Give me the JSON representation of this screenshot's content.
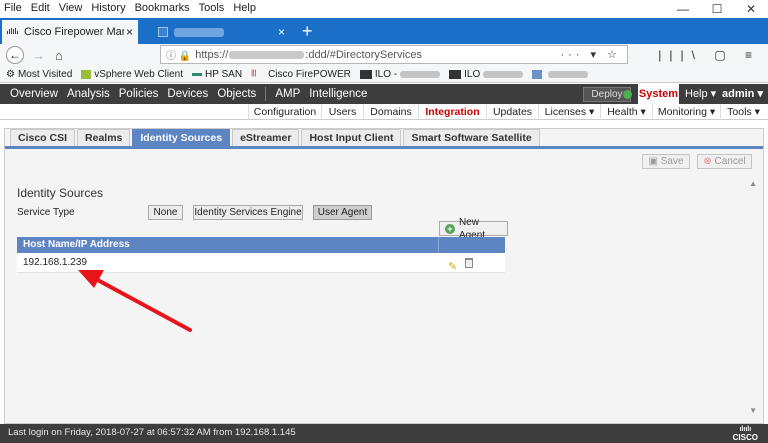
{
  "menubar": {
    "items": [
      "File",
      "Edit",
      "View",
      "History",
      "Bookmarks",
      "Tools",
      "Help"
    ]
  },
  "window_controls": {
    "minimize": "—",
    "maximize": "☐",
    "close": "✕"
  },
  "browser": {
    "tab_active_title": "Cisco Firepower Management",
    "tab_close": "×",
    "new_tab": "+",
    "url_prefix": "https://",
    "url_suffix": ":ddd/#DirectoryServices"
  },
  "bookmarks": {
    "items": [
      {
        "label": "Most Visited",
        "icon": "gear-icon"
      },
      {
        "label": "vSphere Web Client",
        "icon": "vsphere-icon"
      },
      {
        "label": "HP SAN",
        "icon": "hp-icon"
      },
      {
        "label": "Cisco FirePOWER",
        "icon": "cisco-icon"
      },
      {
        "label": "ILO -",
        "icon": "ilo-icon"
      },
      {
        "label": "ILO",
        "icon": "ilo-icon"
      }
    ]
  },
  "fmc_nav": {
    "items": [
      "Overview",
      "Analysis",
      "Policies",
      "Devices",
      "Objects"
    ],
    "items2": [
      "AMP",
      "Intelligence"
    ],
    "deploy": "Deploy",
    "system": "System",
    "help": "Help ▾",
    "admin": "admin ▾"
  },
  "subnav": {
    "items": [
      {
        "label": "Configuration",
        "active": false
      },
      {
        "label": "Users",
        "active": false
      },
      {
        "label": "Domains",
        "active": false
      },
      {
        "label": "Integration",
        "active": true
      },
      {
        "label": "Updates",
        "active": false
      },
      {
        "label": "Licenses ▾",
        "active": false
      },
      {
        "label": "Health ▾",
        "active": false
      },
      {
        "label": "Monitoring ▾",
        "active": false
      },
      {
        "label": "Tools ▾",
        "active": false
      }
    ]
  },
  "page_tabs": [
    {
      "label": "Cisco CSI",
      "active": false
    },
    {
      "label": "Realms",
      "active": false
    },
    {
      "label": "Identity Sources",
      "active": true
    },
    {
      "label": "eStreamer",
      "active": false
    },
    {
      "label": "Host Input Client",
      "active": false
    },
    {
      "label": "Smart Software Satellite",
      "active": false
    }
  ],
  "actions": {
    "save": "Save",
    "cancel": "Cancel"
  },
  "identity": {
    "title": "Identity Sources",
    "service_type_label": "Service Type",
    "options": [
      {
        "label": "None",
        "selected": false
      },
      {
        "label": "Identity Services Engine",
        "selected": false
      },
      {
        "label": "User Agent",
        "selected": true
      }
    ],
    "new_agent": "New Agent",
    "table": {
      "header": "Host Name/IP Address",
      "rows": [
        {
          "host": "192.168.1.239"
        }
      ]
    }
  },
  "annotation": {
    "arrow_color": "#e8141c"
  },
  "status": {
    "last_login": "Last login on Friday, 2018-07-27 at 06:57:32 AM from 192.168.1.145",
    "logo_text": "CISCO"
  },
  "colors": {
    "tab_blue": "#1c6fc7",
    "fmc_dark": "#3d3d3d",
    "accent_red": "#cc0000",
    "table_header": "#5e85c3"
  }
}
